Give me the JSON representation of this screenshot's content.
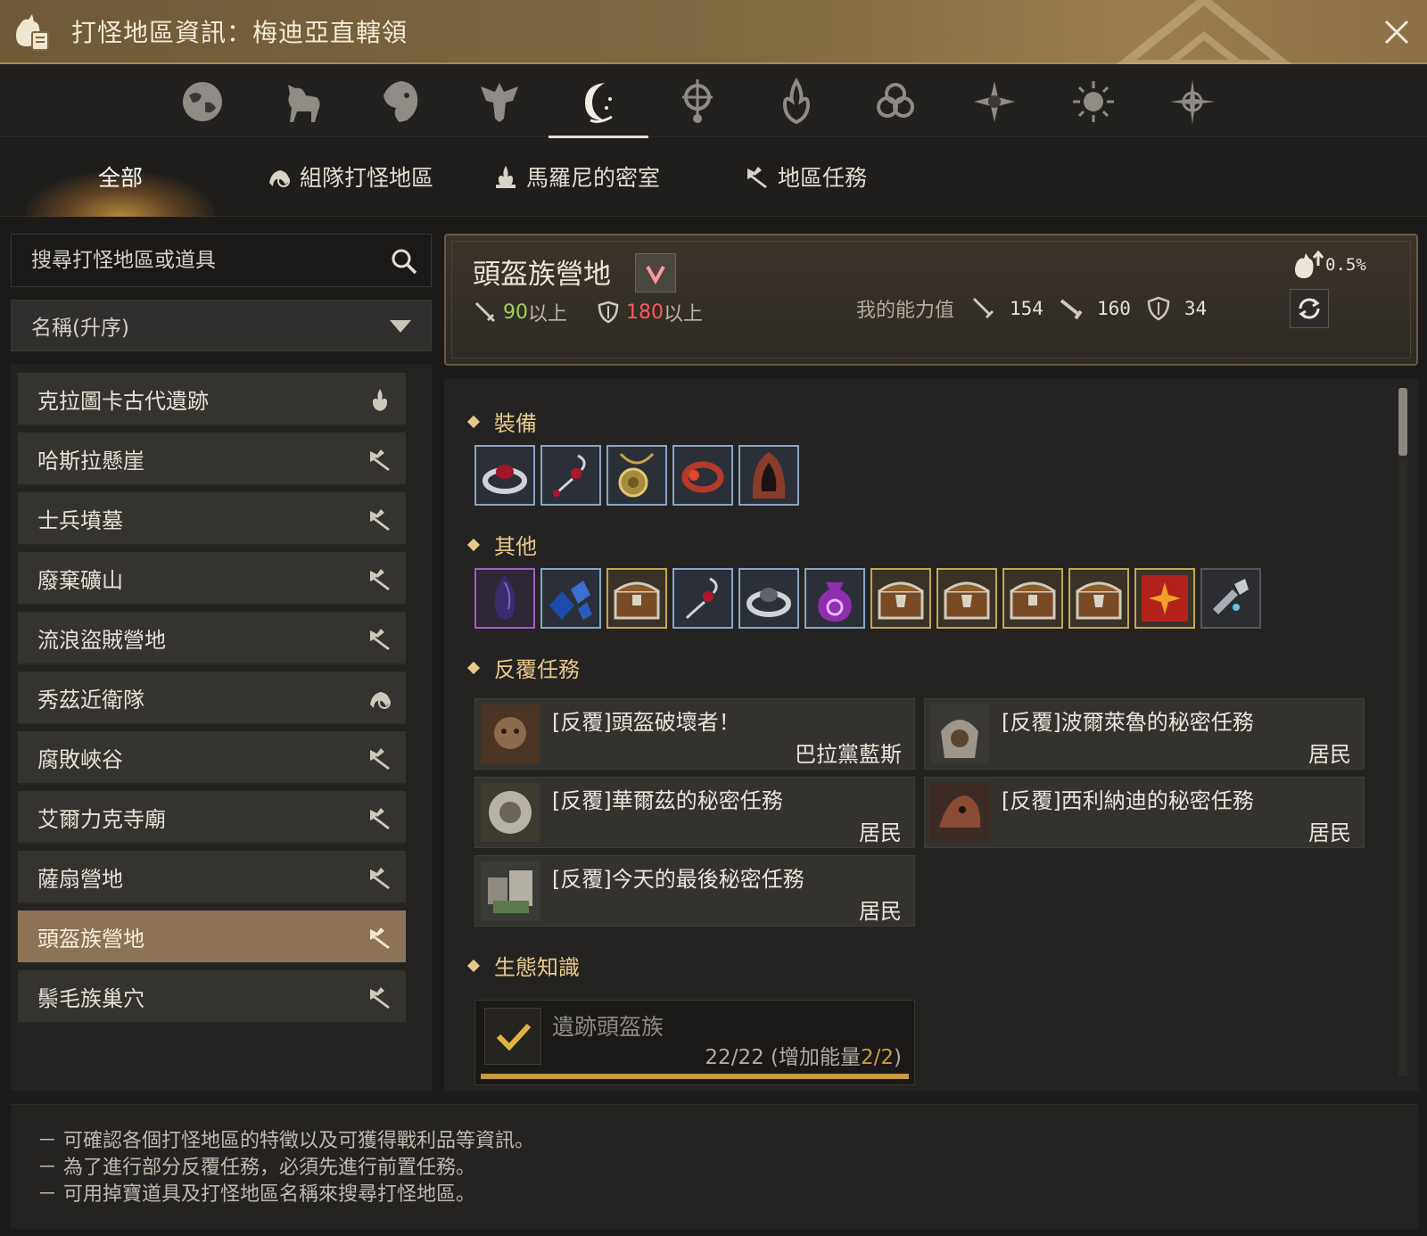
{
  "window": {
    "title": "打怪地區資訊：梅迪亞直轄領"
  },
  "region_tabs": [
    {
      "icon": "globe-icon"
    },
    {
      "icon": "horse-icon"
    },
    {
      "icon": "lion-icon"
    },
    {
      "icon": "eagle-crest-icon"
    },
    {
      "icon": "crescent-moon-icon",
      "active": true
    },
    {
      "icon": "compass-emblem-icon"
    },
    {
      "icon": "flame-emblem-icon"
    },
    {
      "icon": "triquetra-icon"
    },
    {
      "icon": "star-burst-icon"
    },
    {
      "icon": "sun-emblem-icon"
    },
    {
      "icon": "compass-star-icon"
    }
  ],
  "category_tabs": {
    "all": "全部",
    "party": "組隊打怪地區",
    "marni": "馬羅尼的密室",
    "region_quest": "地區任務"
  },
  "search": {
    "placeholder": "搜尋打怪地區或道具"
  },
  "sort": {
    "selected": "名稱(升序)"
  },
  "zone_list": [
    {
      "name": "克拉圖卡古代遺跡",
      "icon": "marni-flame-icon"
    },
    {
      "name": "哈斯拉懸崖",
      "icon": "region-quest-icon"
    },
    {
      "name": "士兵墳墓",
      "icon": "region-quest-icon"
    },
    {
      "name": "廢棄礦山",
      "icon": "region-quest-icon"
    },
    {
      "name": "流浪盜賊營地",
      "icon": "region-quest-icon"
    },
    {
      "name": "秀茲近衛隊",
      "icon": "party-icon"
    },
    {
      "name": "腐敗峽谷",
      "icon": "region-quest-icon"
    },
    {
      "name": "艾爾力克寺廟",
      "icon": "region-quest-icon"
    },
    {
      "name": "薩扇營地",
      "icon": "region-quest-icon"
    },
    {
      "name": "頭盔族營地",
      "icon": "region-quest-icon",
      "selected": true
    },
    {
      "name": "鬃毛族巢穴",
      "icon": "region-quest-icon"
    }
  ],
  "detail": {
    "zone_name": "頭盔族營地",
    "req_ap": "90",
    "req_ap_suffix": "以上",
    "req_dp": "180",
    "req_dp_suffix": "以上",
    "my_stats_label": "我的能力值",
    "my_ap": "154",
    "my_awaken_ap": "160",
    "my_dp": "34",
    "drop_rate": "0.5%"
  },
  "sections": {
    "equipment": "裝備",
    "other": "其他",
    "repeat_quests": "反覆任務",
    "knowledge": "生態知識"
  },
  "equipment_items": [
    {
      "icon": "ring-icon",
      "frame": "blue"
    },
    {
      "icon": "earring-icon",
      "frame": "blue"
    },
    {
      "icon": "necklace-icon",
      "frame": "blue"
    },
    {
      "icon": "red-ring-icon",
      "frame": "blue"
    },
    {
      "icon": "hood-icon",
      "frame": "blue"
    }
  ],
  "other_items": [
    {
      "icon": "purple-gem-icon",
      "frame": "purple"
    },
    {
      "icon": "blue-crystal-icon",
      "frame": "blue"
    },
    {
      "icon": "treasure-chest-icon",
      "frame": "gold"
    },
    {
      "icon": "earring-icon",
      "frame": "blue"
    },
    {
      "icon": "ring-icon",
      "frame": "blue"
    },
    {
      "icon": "pouch-icon",
      "frame": "blue"
    },
    {
      "icon": "treasure-chest-icon",
      "frame": "gold"
    },
    {
      "icon": "treasure-chest-icon",
      "frame": "gold"
    },
    {
      "icon": "treasure-chest-icon",
      "frame": "gold"
    },
    {
      "icon": "treasure-chest-icon",
      "frame": "gold"
    },
    {
      "icon": "red-book-icon",
      "frame": "gold"
    },
    {
      "icon": "silver-shards-icon",
      "frame": "grey"
    }
  ],
  "quests": [
    {
      "name": "[反覆]頭盔破壞者！",
      "npc": "巴拉黨藍斯"
    },
    {
      "name": "[反覆]波爾萊魯的秘密任務",
      "npc": "居民"
    },
    {
      "name": "[反覆]華爾茲的秘密任務",
      "npc": "居民"
    },
    {
      "name": "[反覆]西利納迪的秘密任務",
      "npc": "居民"
    },
    {
      "name": "[反覆]今天的最後秘密任務",
      "npc": "居民"
    }
  ],
  "knowledge": {
    "name": "遺跡頭盔族",
    "progress_main": "22/22 (增加能量",
    "progress_accent": "2/2",
    "progress_end": ")",
    "progress_fraction": 1.0
  },
  "footer": {
    "lines": [
      "－ 可確認各個打怪地區的特徵以及可獲得戰利品等資訊。",
      "－ 為了進行部分反覆任務，必須先進行前置任務。",
      "－ 可用掉寶道具及打怪地區名稱來搜尋打怪地區。"
    ]
  },
  "colors": {
    "accent_gold": "#e7c98a",
    "selected_row": "#8c7356",
    "req_ok": "#9bd35a",
    "req_bad": "#ff5a5a"
  }
}
